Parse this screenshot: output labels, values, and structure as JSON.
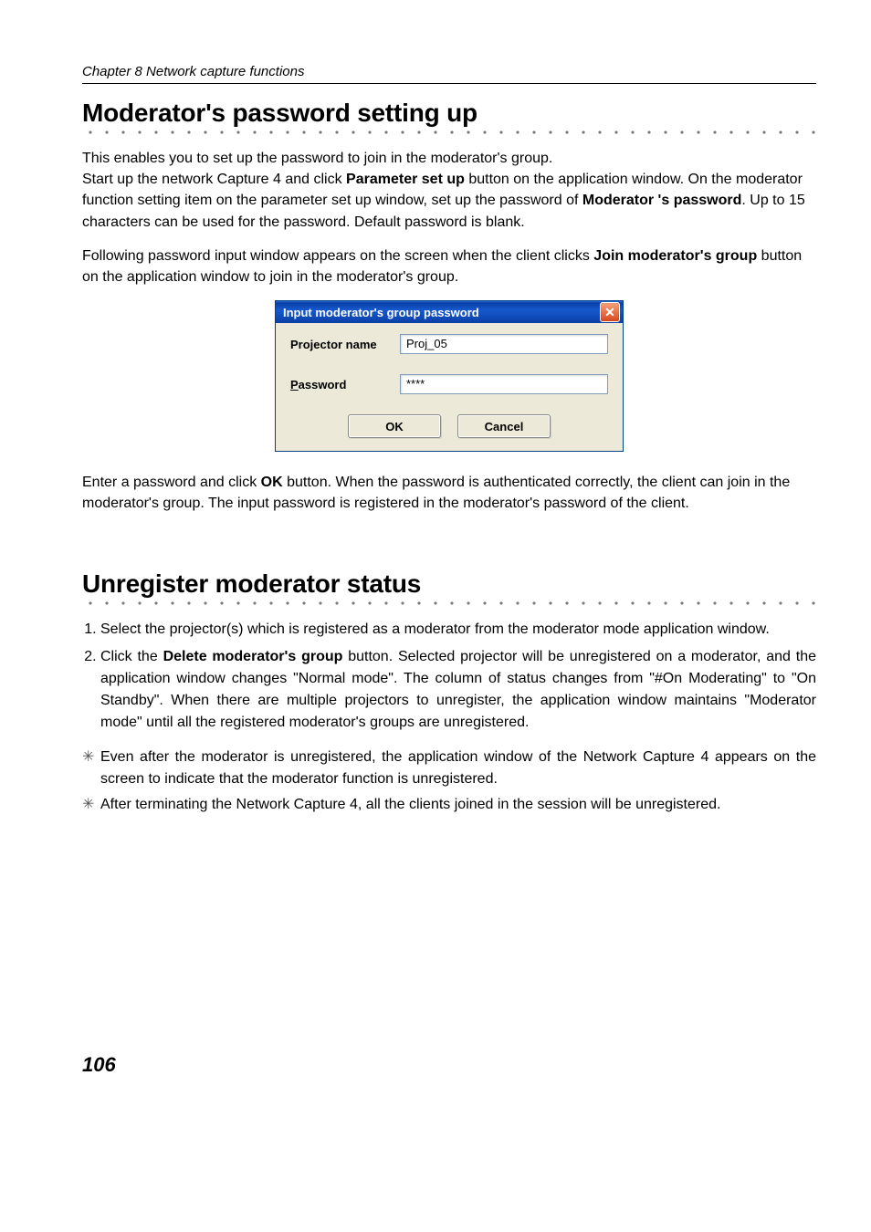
{
  "running_head": "Chapter 8 Network capture functions",
  "section1": {
    "title": "Moderator's password setting up",
    "p1": {
      "t1": "This enables you to set up the password to join in the moderator's group."
    },
    "p2": {
      "t1": "Start up the network Capture 4 and click ",
      "b1": "Parameter set up",
      "t2": " button on the application window. On the moderator function setting item on the parameter set up window, set up the password of ",
      "b2": "Moderator 's password",
      "t3": ". Up to 15 characters can be used for the password. Default  password is blank."
    },
    "p3": {
      "t1": "Following password input window appears on the screen when the client clicks ",
      "b1": "Join moderator's group",
      "t2": " button on the application window to join in the moderator's group."
    },
    "p4": {
      "t1": "Enter a password and click ",
      "b1": "OK",
      "t2": " button. When the password is authenticated correctly, the client can join in the moderator's group. The input password is registered in the moderator's password of the client."
    }
  },
  "dialog": {
    "title": "Input moderator's group password",
    "close_glyph": "✕",
    "projector_label": "Projector name",
    "projector_value": "Proj_05",
    "password_label_underline": "P",
    "password_label_rest": "assword",
    "password_value": "****",
    "ok_label": "OK",
    "cancel_label": "Cancel"
  },
  "section2": {
    "title": "Unregister moderator status",
    "step1": "Select the projector(s) which is registered as a moderator from the moderator mode application window.",
    "step2": {
      "t1": "Click the ",
      "b1": "Delete moderator's group",
      "t2": " button. Selected projector will be unregistered on a moderator, and the application window changes \"Normal mode\".  The column of status changes from \"#On Moderating\" to \"On Standby\". When there are multiple projectors to unregister, the application window maintains \"Moderator mode\" until all the registered moderator's groups are unregistered."
    },
    "note1": "Even after the moderator is unregistered, the application window of the Network Capture 4 appears on the screen to indicate that the moderator function is unregistered.",
    "note2": "After terminating the Network Capture 4, all the clients joined in the session will be unregistered."
  },
  "note_mark": "✳",
  "page_number": "106"
}
